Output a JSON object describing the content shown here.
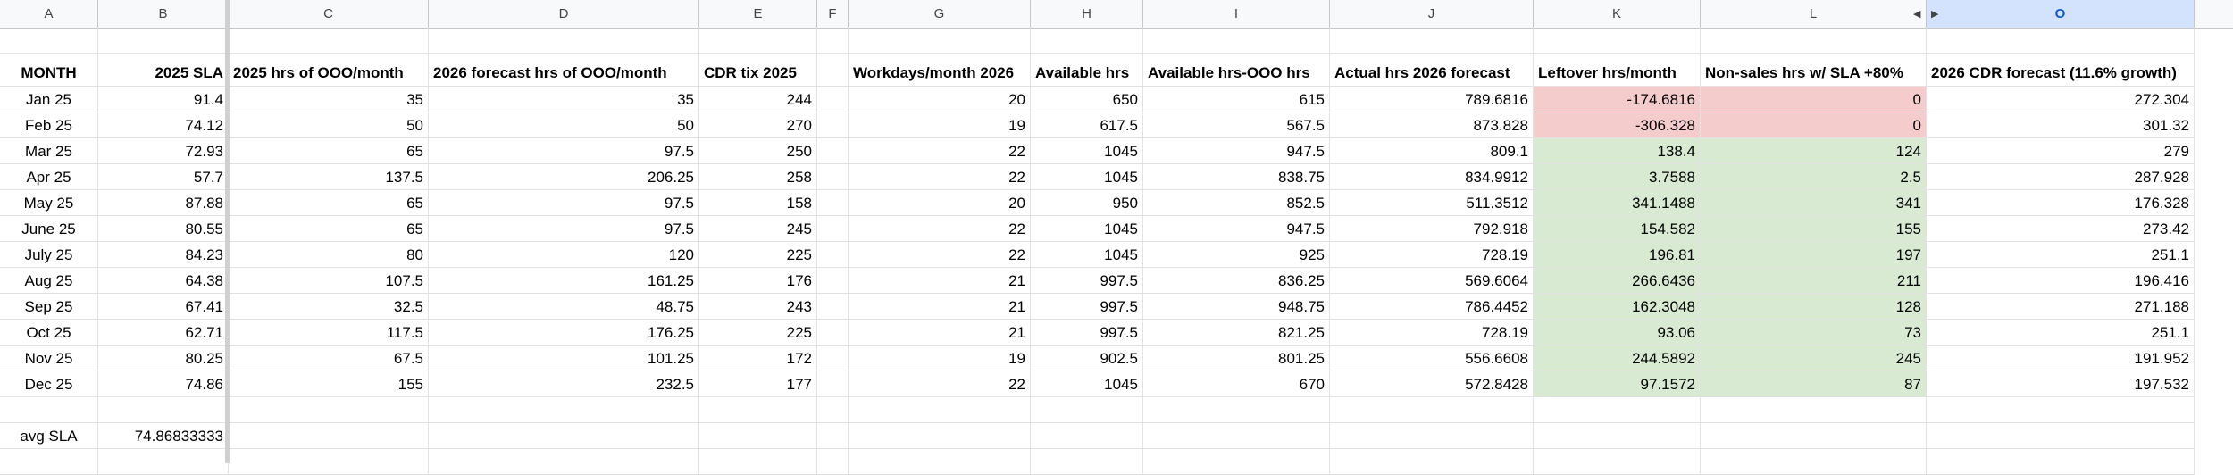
{
  "column_letters": [
    "A",
    "B",
    "C",
    "D",
    "E",
    "F",
    "G",
    "H",
    "I",
    "J",
    "K",
    "L",
    "O"
  ],
  "header_row": [
    "MONTH",
    "2025 SLA",
    "2025 hrs of OOO/month",
    "2026 forecast hrs of OOO/month",
    "CDR tix 2025",
    "",
    "Workdays/month 2026",
    "Available hrs",
    "Available hrs-OOO hrs",
    "Actual hrs 2026 forecast",
    "Leftover hrs/month",
    "Non-sales hrs w/ SLA +80%",
    "2026 CDR forecast (11.6% growth)"
  ],
  "rows": [
    [
      "Jan 25",
      "91.4",
      "35",
      "35",
      "244",
      "",
      "20",
      "650",
      "615",
      "789.6816",
      "-174.6816",
      "0",
      "272.304"
    ],
    [
      "Feb 25",
      "74.12",
      "50",
      "50",
      "270",
      "",
      "19",
      "617.5",
      "567.5",
      "873.828",
      "-306.328",
      "0",
      "301.32"
    ],
    [
      "Mar 25",
      "72.93",
      "65",
      "97.5",
      "250",
      "",
      "22",
      "1045",
      "947.5",
      "809.1",
      "138.4",
      "124",
      "279"
    ],
    [
      "Apr 25",
      "57.7",
      "137.5",
      "206.25",
      "258",
      "",
      "22",
      "1045",
      "838.75",
      "834.9912",
      "3.7588",
      "2.5",
      "287.928"
    ],
    [
      "May 25",
      "87.88",
      "65",
      "97.5",
      "158",
      "",
      "20",
      "950",
      "852.5",
      "511.3512",
      "341.1488",
      "341",
      "176.328"
    ],
    [
      "June 25",
      "80.55",
      "65",
      "97.5",
      "245",
      "",
      "22",
      "1045",
      "947.5",
      "792.918",
      "154.582",
      "155",
      "273.42"
    ],
    [
      "July 25",
      "84.23",
      "80",
      "120",
      "225",
      "",
      "22",
      "1045",
      "925",
      "728.19",
      "196.81",
      "197",
      "251.1"
    ],
    [
      "Aug 25",
      "64.38",
      "107.5",
      "161.25",
      "176",
      "",
      "21",
      "997.5",
      "836.25",
      "569.6064",
      "266.6436",
      "211",
      "196.416"
    ],
    [
      "Sep 25",
      "67.41",
      "32.5",
      "48.75",
      "243",
      "",
      "21",
      "997.5",
      "948.75",
      "786.4452",
      "162.3048",
      "128",
      "271.188"
    ],
    [
      "Oct 25",
      "62.71",
      "117.5",
      "176.25",
      "225",
      "",
      "21",
      "997.5",
      "821.25",
      "728.19",
      "93.06",
      "73",
      "251.1"
    ],
    [
      "Nov 25",
      "80.25",
      "67.5",
      "101.25",
      "172",
      "",
      "19",
      "902.5",
      "801.25",
      "556.6608",
      "244.5892",
      "245",
      "191.952"
    ],
    [
      "Dec 25",
      "74.86",
      "155",
      "232.5",
      "177",
      "",
      "22",
      "1045",
      "670",
      "572.8428",
      "97.1572",
      "87",
      "197.532"
    ]
  ],
  "summary": {
    "label": "avg SLA",
    "value": "74.86833333"
  },
  "colors": {
    "negative_fill": "#f4cccc",
    "positive_fill": "#d9ead3",
    "selected_header": "#d3e3fd"
  }
}
